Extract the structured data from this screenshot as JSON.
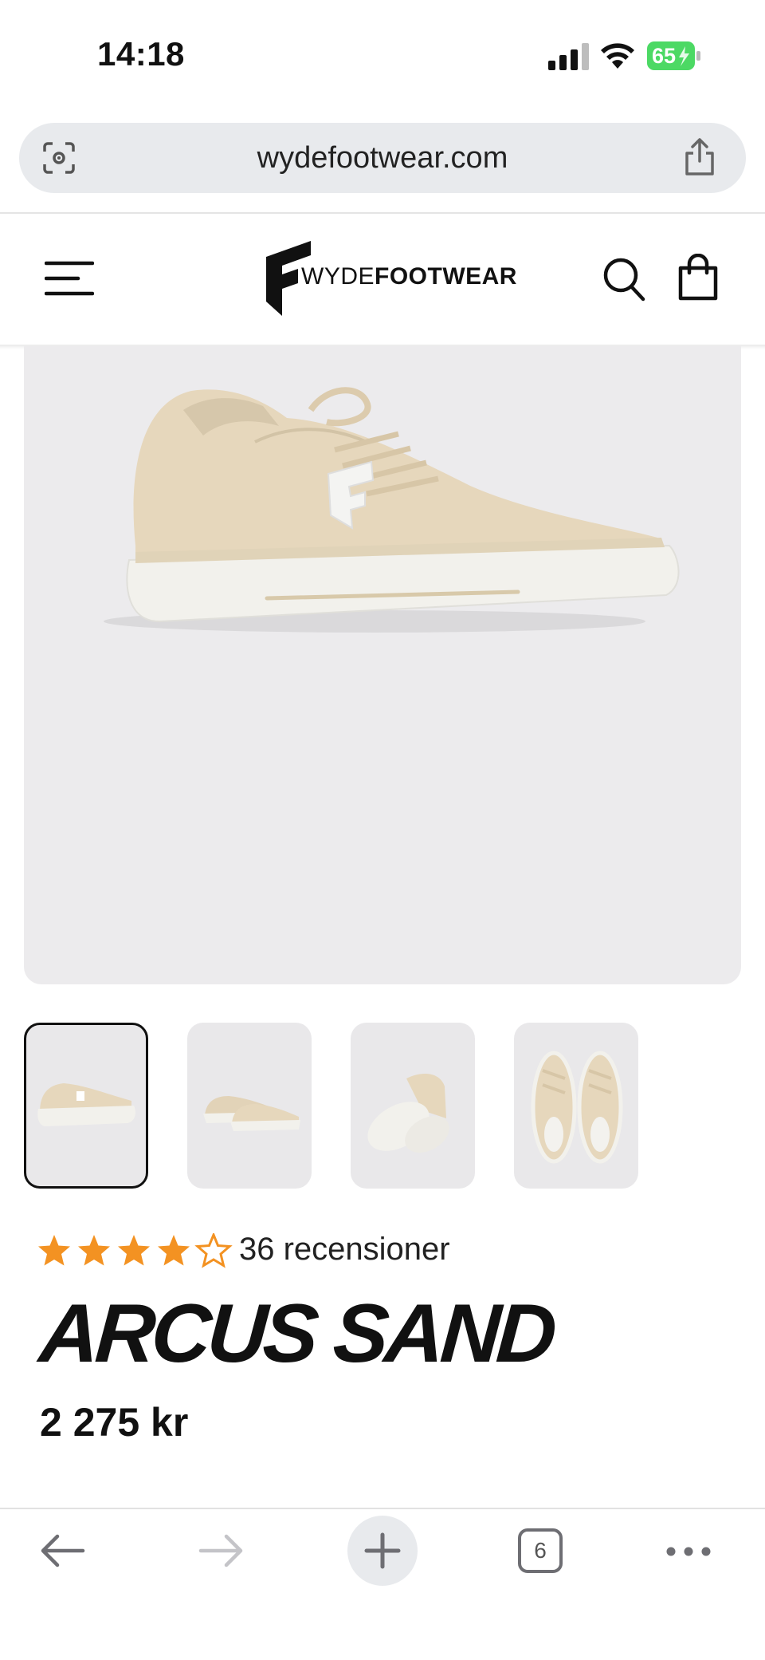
{
  "status_bar": {
    "time": "14:18",
    "battery_level": "65"
  },
  "browser": {
    "url": "wydefootwear.com",
    "tab_count": "6"
  },
  "site": {
    "logo_prefix": "WYDE",
    "logo_bold": "FOOTWEAR"
  },
  "product": {
    "rating": 4.5,
    "rating_max": 5,
    "review_label": "36 recensioner",
    "name": "ARCUS SAND",
    "price": "2 275 kr",
    "thumbnail_count": 4,
    "selected_thumbnail": 1
  },
  "colors": {
    "star": "#f39222",
    "battery_green": "#4cd964",
    "shoe_beige": "#e6d7bc",
    "sole_white": "#f2f1ec"
  },
  "icons": [
    "lens-icon",
    "share-icon",
    "menu-icon",
    "search-icon",
    "bag-icon",
    "back-icon",
    "forward-icon",
    "plus-icon",
    "more-icon"
  ]
}
